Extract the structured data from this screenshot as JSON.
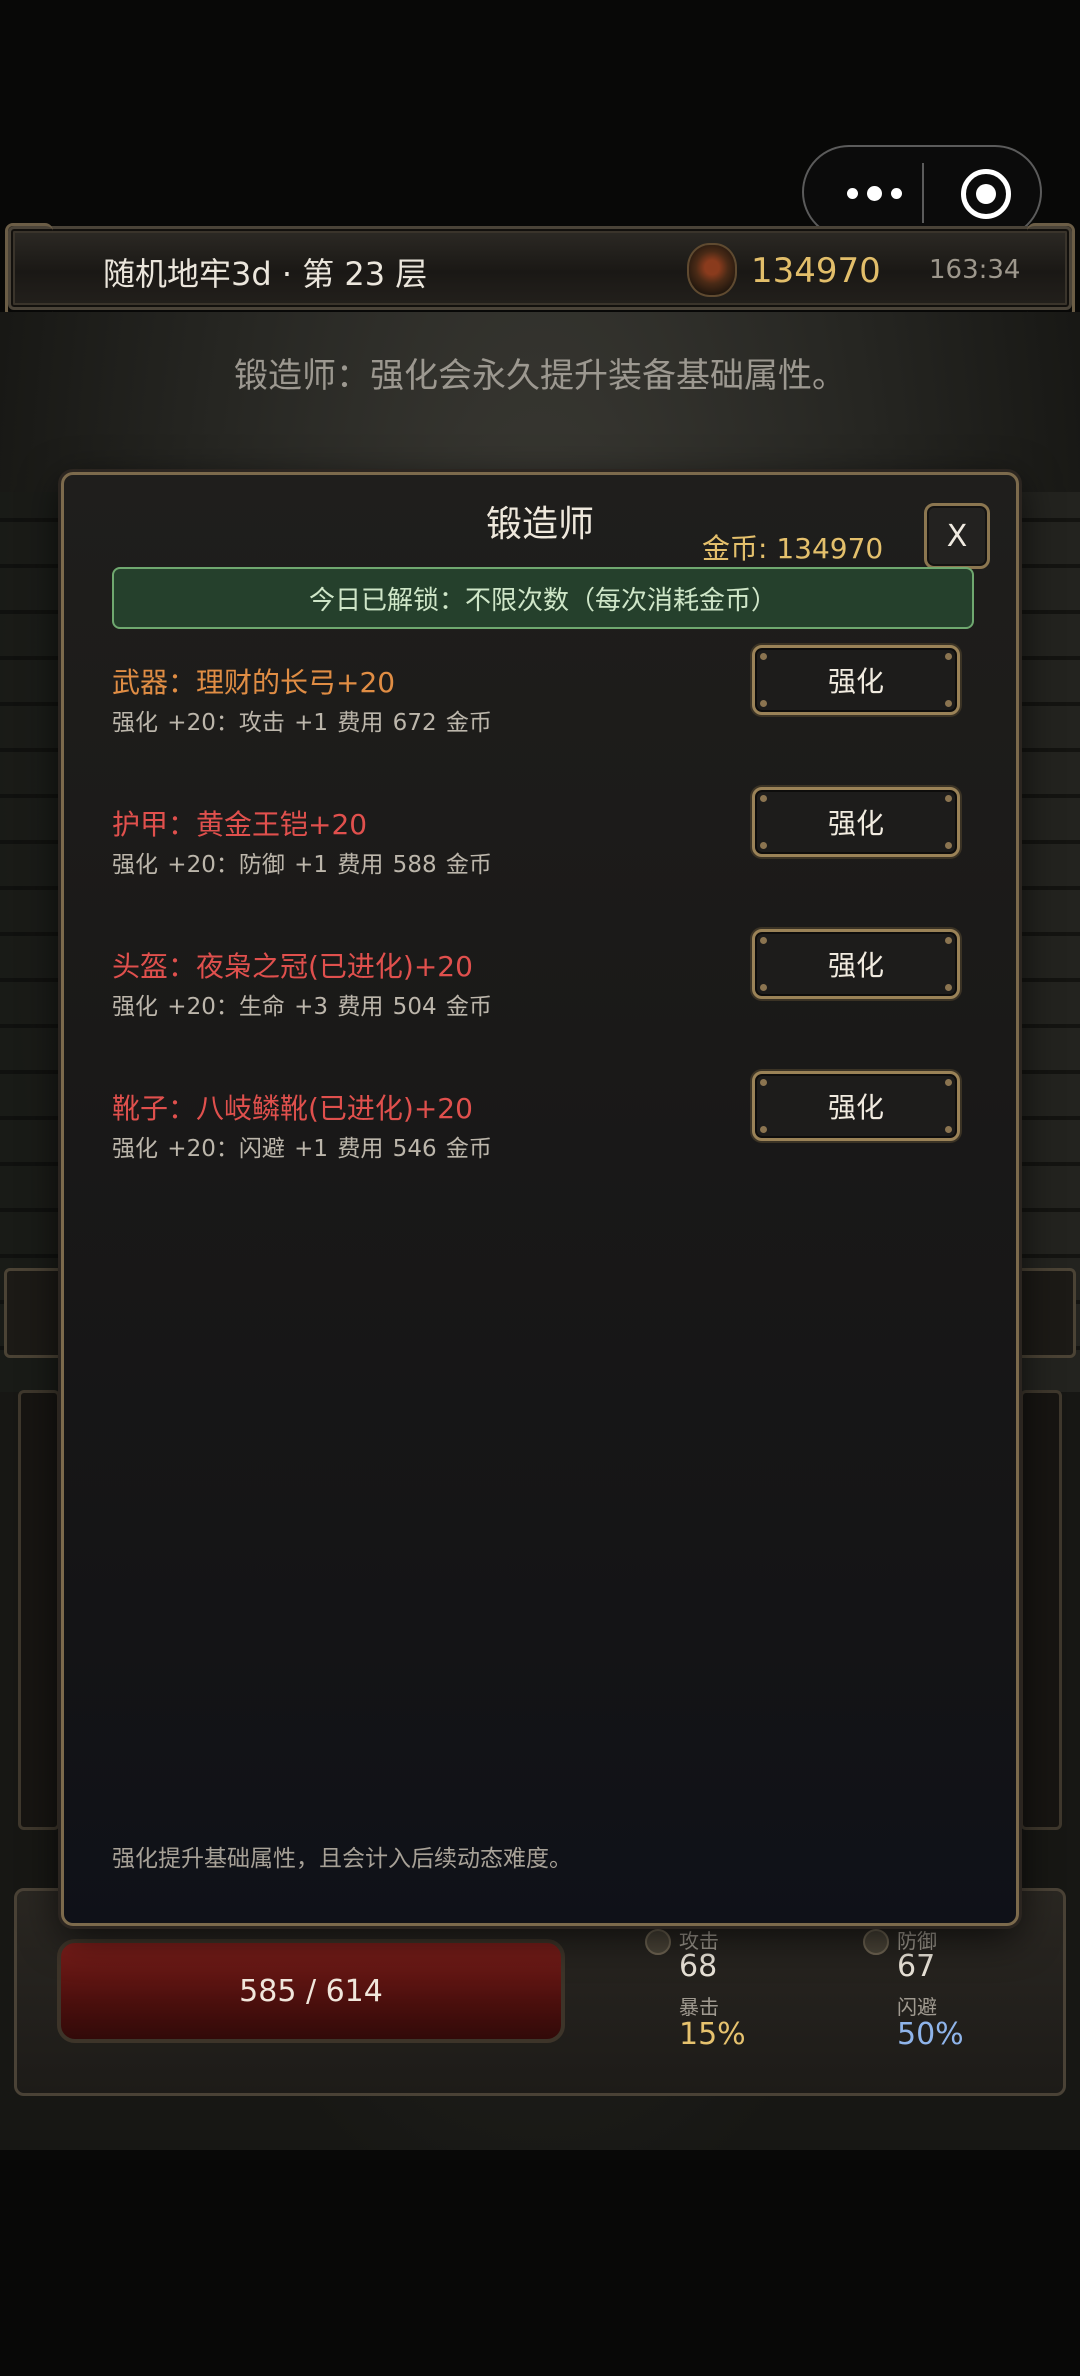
{
  "header": {
    "title": "随机地牢3d · 第 23 层",
    "gold": "134970",
    "time": "163:34"
  },
  "background": {
    "hint": "锻造师：强化会永久提升装备基础属性。",
    "hud": {
      "hp": "585 / 614",
      "attack_label": "攻击",
      "attack": "68",
      "defense_label": "防御",
      "defense": "67",
      "crit_label": "暴击",
      "crit": "15%",
      "dodge_label": "闪避",
      "dodge": "50%"
    }
  },
  "modal": {
    "title": "锻造师",
    "gold": "金币: 134970",
    "close_label": "X",
    "unlock": "今日已解锁：不限次数（每次消耗金币）",
    "items": [
      {
        "name": "武器：理财的长弓+20",
        "desc": "强化 +20：攻击 +1   费用 672 金币",
        "button": "强化",
        "color": "#e08d44"
      },
      {
        "name": "护甲：黄金王铠+20",
        "desc": "强化 +20：防御 +1   费用 588 金币",
        "button": "强化",
        "color": "#e0504d"
      },
      {
        "name": "头盔：夜枭之冠(已进化)+20",
        "desc": "强化 +20：生命 +3   费用 504 金币",
        "button": "强化",
        "color": "#e0504d"
      },
      {
        "name": "靴子：八岐鳞靴(已进化)+20",
        "desc": "强化 +20：闪避 +1   费用 546 金币",
        "button": "强化",
        "color": "#e0504d"
      }
    ],
    "footer": "强化提升基础属性，且会计入后续动态难度。"
  }
}
